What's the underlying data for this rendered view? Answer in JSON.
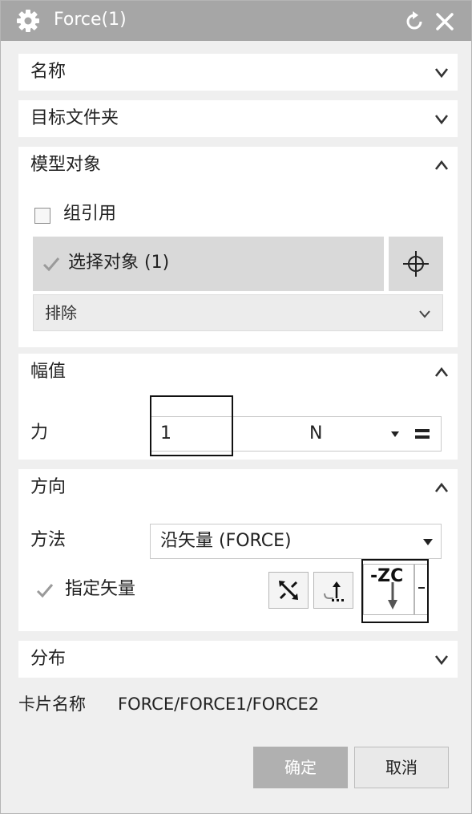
{
  "dialog": {
    "title": "Force(1)",
    "icons": {
      "settings": "gear-icon",
      "reset": "reset-icon",
      "close": "close-icon"
    }
  },
  "sections": {
    "name": {
      "label": "名称",
      "state": "collapsed"
    },
    "target_folder": {
      "label": "目标文件夹",
      "state": "collapsed"
    },
    "model_object": {
      "label": "模型对象",
      "state": "expanded",
      "group_reference_label": "组引用",
      "group_reference_checked": false,
      "select_object_label": "选择对象 (1)",
      "exclude_label": "排除"
    },
    "amplitude": {
      "label": "幅值",
      "state": "expanded",
      "force_label": "力",
      "force_value": "1",
      "force_unit": "N"
    },
    "direction": {
      "label": "方向",
      "state": "expanded",
      "method_label": "方法",
      "method_value": "沿矢量 (FORCE)",
      "specify_vector_label": "指定矢量",
      "vector_value": "-ZC"
    },
    "distribution": {
      "label": "分布",
      "state": "collapsed"
    }
  },
  "card": {
    "label": "卡片名称",
    "value": "FORCE/FORCE1/FORCE2"
  },
  "buttons": {
    "ok": "确定",
    "cancel": "取消"
  },
  "colors": {
    "titlebar": "#a6a6a6",
    "panel_bg": "#efefef",
    "section_bg": "#ffffff",
    "ok_disabled": "#b0b0b0"
  }
}
